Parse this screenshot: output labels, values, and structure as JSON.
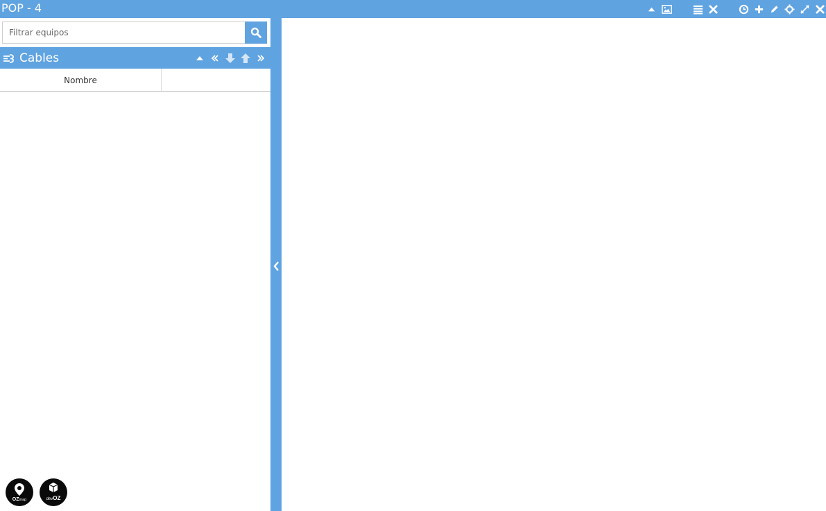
{
  "window": {
    "title": "POP - 4"
  },
  "toolbar": {
    "icons": [
      "collapse-up-icon",
      "image-icon",
      "list-icon",
      "close-x-icon",
      "clock-icon",
      "plus-icon",
      "pencil-icon",
      "crosshair-icon",
      "expand-icon",
      "close-icon"
    ]
  },
  "search": {
    "placeholder": "Filtrar equipos",
    "value": ""
  },
  "panel": {
    "title": "Cables",
    "controls": [
      "collapse-up-icon",
      "double-left-icon",
      "arrow-down-icon",
      "arrow-up-icon",
      "double-right-icon"
    ]
  },
  "table": {
    "columns": [
      "Nombre",
      ""
    ],
    "rows": []
  },
  "logos": [
    {
      "name": "ozmap-logo",
      "text": "OZmap"
    },
    {
      "name": "devoz-logo",
      "text": "devOZ"
    }
  ],
  "colors": {
    "accent": "#5fa3e0",
    "background": "#ffffff",
    "border": "#d8d8d8"
  }
}
